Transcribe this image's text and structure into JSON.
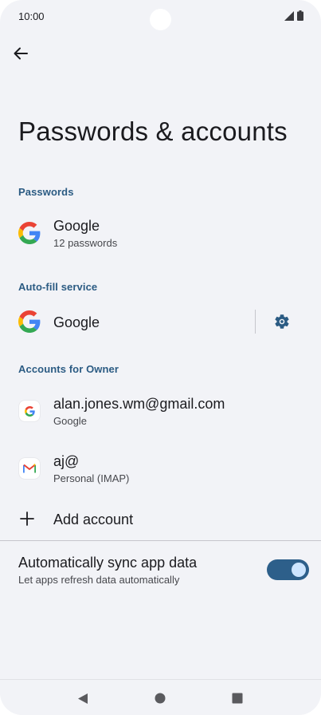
{
  "status_bar": {
    "time": "10:00"
  },
  "page": {
    "title": "Passwords & accounts"
  },
  "passwords": {
    "header": "Passwords",
    "item": {
      "title": "Google",
      "subtitle": "12 passwords",
      "icon": "google-g-icon"
    }
  },
  "autofill": {
    "header": "Auto-fill service",
    "item": {
      "title": "Google",
      "icon": "google-g-icon"
    }
  },
  "accounts": {
    "header": "Accounts for Owner",
    "items": [
      {
        "title": "alan.jones.wm@gmail.com",
        "subtitle": "Google",
        "icon": "google-account-icon"
      },
      {
        "title": "aj@",
        "subtitle": "Personal (IMAP)",
        "icon": "gmail-icon"
      }
    ],
    "add_label": "Add account"
  },
  "sync": {
    "title": "Automatically sync app data",
    "subtitle": "Let apps refresh data automatically",
    "enabled": true
  },
  "colors": {
    "accent": "#2b5b83",
    "toggle_track": "#2d5f8a",
    "toggle_knob": "#cde5ff",
    "background": "#f2f3f7"
  }
}
